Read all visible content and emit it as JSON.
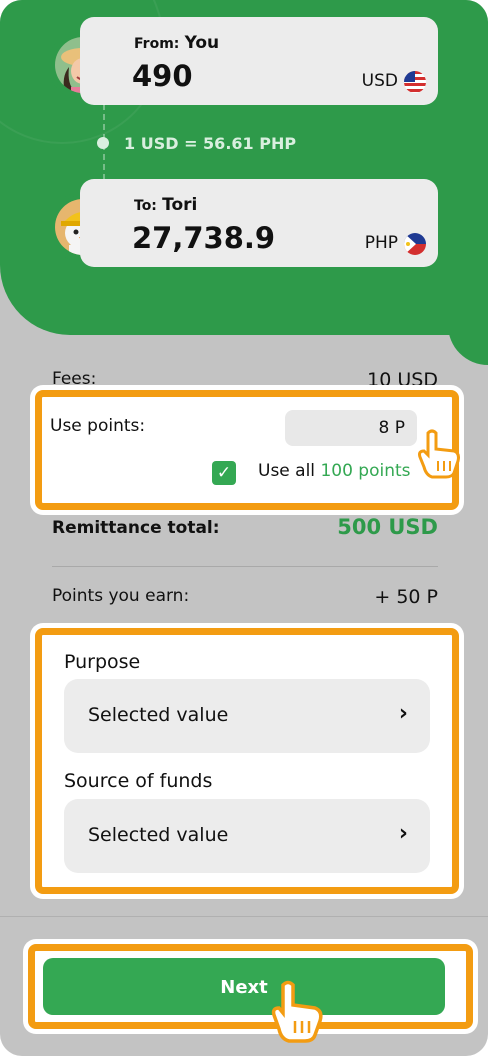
{
  "from": {
    "prefix": "From:",
    "name": "You",
    "amount": "490",
    "currency": "USD",
    "flag_icon": "us-flag-icon"
  },
  "rate": "1 USD = 56.61 PHP",
  "to": {
    "prefix": "To:",
    "name": "Tori",
    "amount": "27,738.9",
    "currency": "PHP",
    "flag_icon": "ph-flag-icon"
  },
  "fees": {
    "label": "Fees:",
    "value": "10 USD"
  },
  "points": {
    "label": "Use points:",
    "value": "8 P",
    "use_all_prefix": "Use all",
    "use_all_amount": "100 points",
    "use_all_checked": true
  },
  "remittance": {
    "label": "Remittance total:",
    "value": "500 USD"
  },
  "earn": {
    "label": "Points you earn:",
    "value": "+ 50 P"
  },
  "purpose": {
    "label": "Purpose",
    "value": "Selected value"
  },
  "source": {
    "label": "Source of funds",
    "value": "Selected value"
  },
  "next_label": "Next",
  "colors": {
    "brand_green": "#2e9a4a",
    "accent_green": "#34a853",
    "highlight_orange": "#f39c12"
  }
}
